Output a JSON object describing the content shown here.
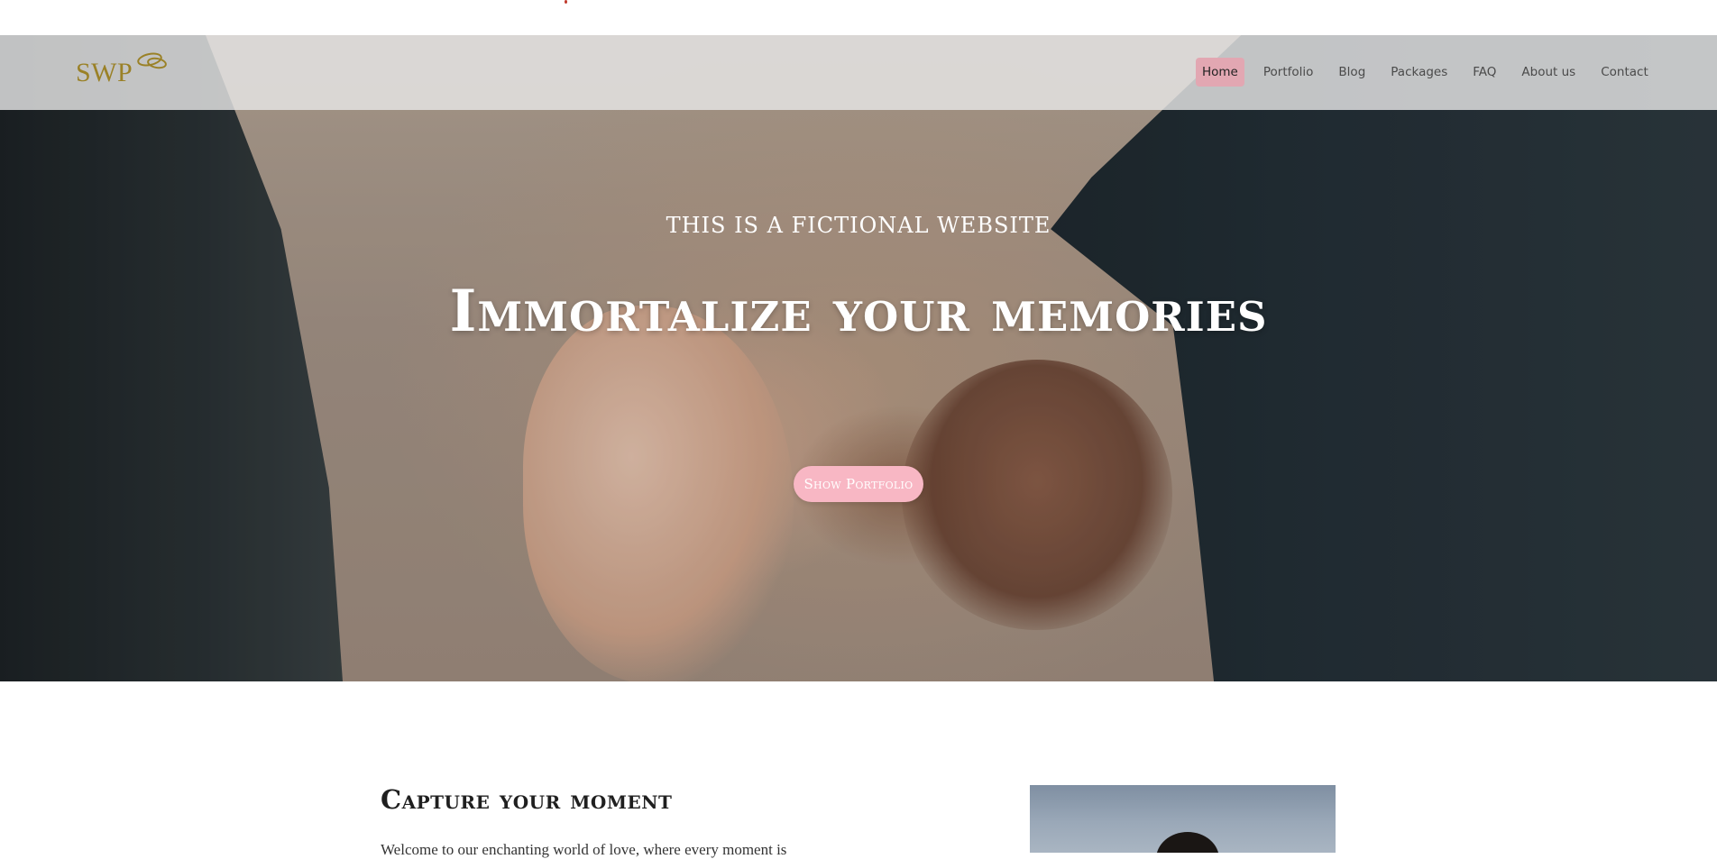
{
  "brand": {
    "logo_text": "SWP",
    "logo_color": "#9a8127"
  },
  "nav": {
    "items": [
      {
        "label": "Home",
        "active": true
      },
      {
        "label": "Portfolio",
        "active": false
      },
      {
        "label": "Blog",
        "active": false
      },
      {
        "label": "Packages",
        "active": false
      },
      {
        "label": "FAQ",
        "active": false
      },
      {
        "label": "About us",
        "active": false
      },
      {
        "label": "Contact",
        "active": false
      }
    ],
    "active_color": "#e2a7b2"
  },
  "hero": {
    "subtitle": "THIS IS A FICTIONAL WEBSITE",
    "title": "Immortalize your memories",
    "button_label": "Show Portfolio",
    "button_color": "#f8b7c4"
  },
  "intro": {
    "title": "Capture your moment",
    "text": "Welcome to our enchanting world of love, where every moment is"
  }
}
